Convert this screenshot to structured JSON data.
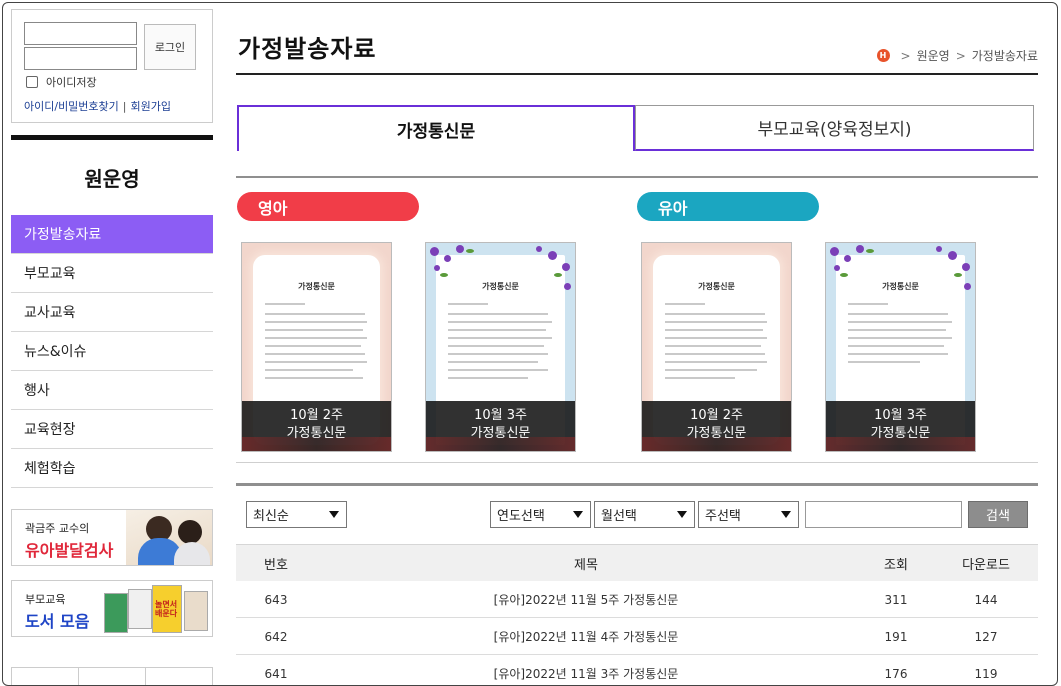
{
  "login": {
    "login_button": "로그인",
    "save_id_label": "아이디저장",
    "find_link": "아이디/비밀번호찾기",
    "separator": "|",
    "join_link": "회원가입"
  },
  "sidebar": {
    "title": "원운영",
    "items": [
      {
        "label": "가정발송자료",
        "active": true
      },
      {
        "label": "부모교육"
      },
      {
        "label": "교사교육"
      },
      {
        "label": "뉴스&이슈"
      },
      {
        "label": "행사"
      },
      {
        "label": "교육현장"
      },
      {
        "label": "체험학습"
      }
    ],
    "banner1": {
      "small": "곽금주 교수의",
      "big": "유아발달검사"
    },
    "banner2": {
      "small": "부모교육",
      "big": "도서 모음",
      "book_text": "놀면서 배운다"
    }
  },
  "header": {
    "title": "가정발송자료",
    "home_icon": "H",
    "breadcrumb": [
      "원운영",
      "가정발송자료"
    ],
    "breadcrumb_sep": ">"
  },
  "tabs": [
    {
      "label": "가정통신문",
      "active": true
    },
    {
      "label": "부모교육(양육정보지)"
    }
  ],
  "sections": {
    "infant": {
      "label": "영아",
      "color": "#f13d48"
    },
    "child": {
      "label": "유아",
      "color": "#1ba6c1"
    }
  },
  "cards": [
    {
      "week": "10월 2주",
      "type": "가정통신문",
      "doc_title": "가정통신문",
      "style": "peach"
    },
    {
      "week": "10월 3주",
      "type": "가정통신문",
      "doc_title": "가정통신문",
      "style": "blue"
    },
    {
      "week": "10월 2주",
      "type": "가정통신문",
      "doc_title": "가정통신문",
      "style": "peach"
    },
    {
      "week": "10월 3주",
      "type": "가정통신문",
      "doc_title": "가정통신문",
      "style": "blue"
    }
  ],
  "filters": {
    "sort": "최신순",
    "year": "연도선택",
    "month": "월선택",
    "week": "주선택",
    "search_button": "검색",
    "search_value": ""
  },
  "table": {
    "headers": {
      "num": "번호",
      "title": "제목",
      "views": "조회",
      "downloads": "다운로드"
    },
    "rows": [
      {
        "num": "643",
        "title": "[유아]2022년 11월 5주 가정통신문",
        "views": "311",
        "downloads": "144"
      },
      {
        "num": "642",
        "title": "[유아]2022년 11월 4주 가정통신문",
        "views": "191",
        "downloads": "127"
      },
      {
        "num": "641",
        "title": "[유아]2022년 11월 3주 가정통신문",
        "views": "176",
        "downloads": "119"
      }
    ]
  }
}
